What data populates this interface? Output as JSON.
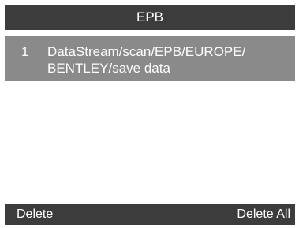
{
  "title_bar": {
    "title": "EPB"
  },
  "list": {
    "items": [
      {
        "index": "1",
        "line1": "DataStream/scan/EPB/EUROPE/",
        "line2": "BENTLEY/save data",
        "selected": true
      }
    ]
  },
  "bottom_bar": {
    "left_label": "Delete",
    "right_label": "Delete All"
  },
  "colors": {
    "bar_background": "#3c3c3c",
    "selected_row": "#8a8a8a",
    "text": "#ffffff",
    "list_background": "#ffffff"
  }
}
